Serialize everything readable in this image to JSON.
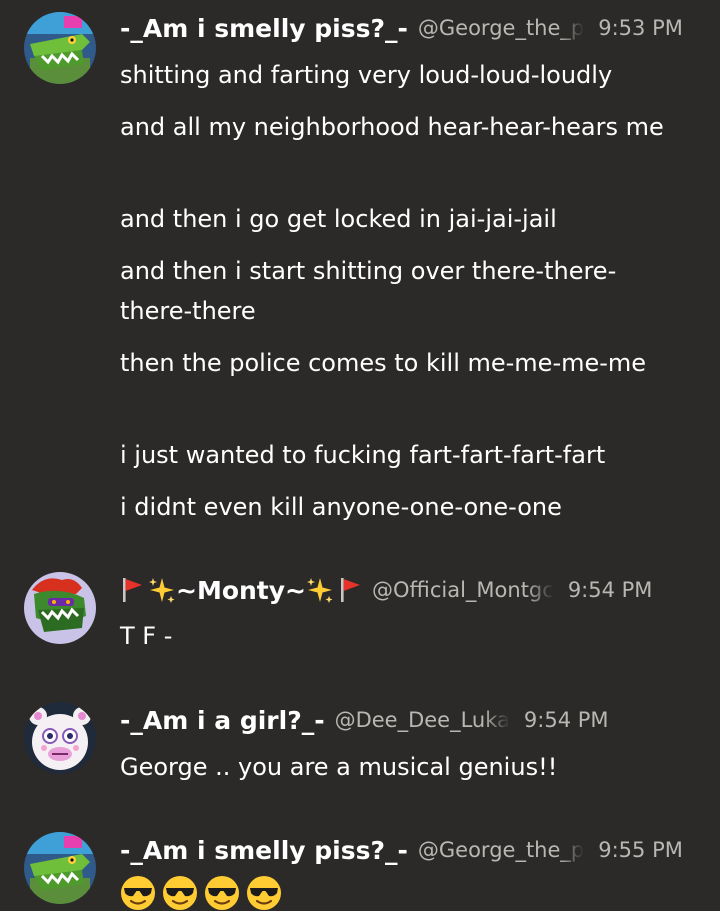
{
  "messages": [
    {
      "author": {
        "display_name": "-_Am i smelly piss?_-",
        "handle": "@George_the_p",
        "avatar": "green-crocodile-avatar"
      },
      "time": "9:53 PM",
      "lines": [
        "shitting and farting very loud-loud-loudly",
        "and all my neighborhood hear-hear-hears me",
        "and then i go get locked in jai-jai-jail",
        "and then i start shitting over there-there-there-there",
        "then the police comes to kill me-me-me-me",
        "i just wanted to fucking fart-fart-fart-fart",
        "i didnt even kill anyone-one-one-one"
      ]
    },
    {
      "author": {
        "display_name": "~Monty~",
        "handle": "@Official_Montgc",
        "avatar": "monty-gator-avatar",
        "name_decorations": [
          "red-flag-icon",
          "sparkles-icon",
          "sparkles-icon",
          "red-flag-icon"
        ]
      },
      "time": "9:54 PM",
      "lines": [
        "T F -"
      ]
    },
    {
      "author": {
        "display_name": "-_Am i a girl?_-",
        "handle": "@Dee_Dee_Luka",
        "avatar": "white-bear-avatar"
      },
      "time": "9:54 PM",
      "lines": [
        "George .. you are a musical genius!!"
      ]
    },
    {
      "author": {
        "display_name": "-_Am i smelly piss?_-",
        "handle": "@George_the_p",
        "avatar": "green-crocodile-avatar"
      },
      "time": "9:55 PM",
      "emojis": [
        "sunglasses-emoji",
        "sunglasses-emoji",
        "sunglasses-emoji",
        "sunglasses-emoji"
      ]
    }
  ],
  "colors": {
    "background": "#2b2a28",
    "text": "#ffffff",
    "muted": "#b9b7b3"
  }
}
